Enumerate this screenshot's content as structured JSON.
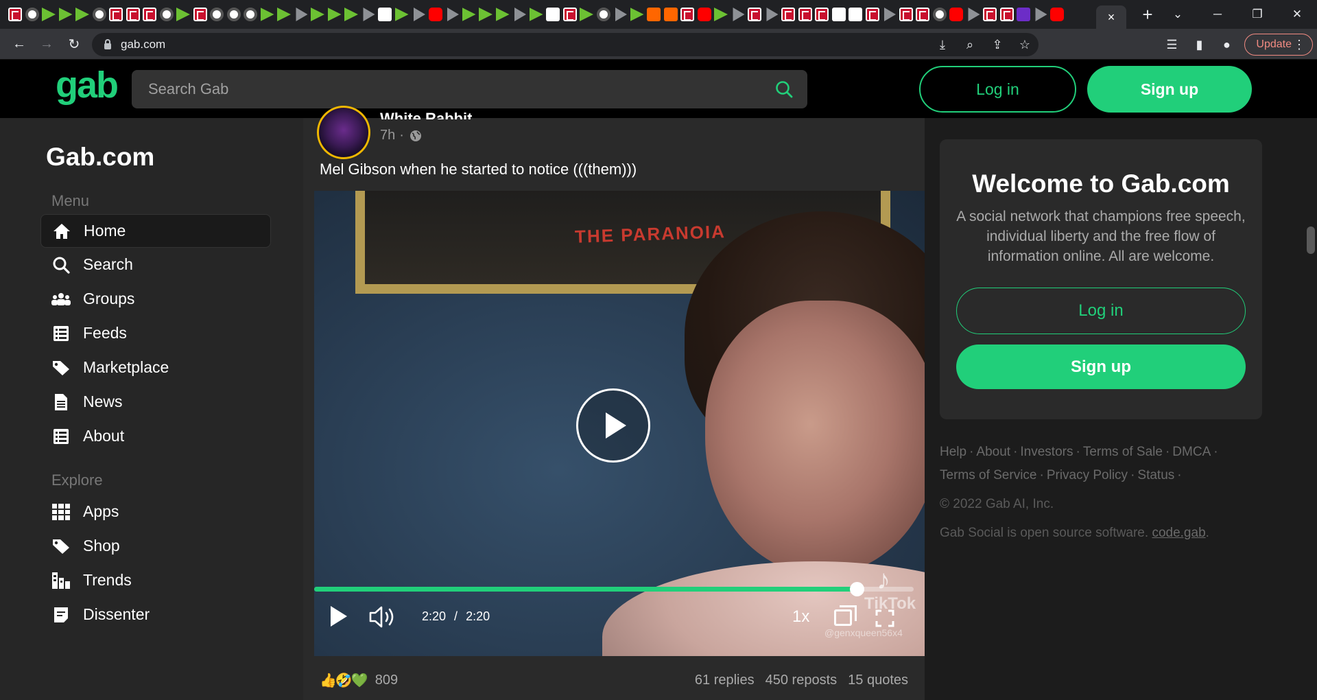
{
  "browser": {
    "url": "gab.com",
    "update_label": "Update",
    "active_tab_close": "×",
    "new_tab": "+",
    "mini_tabs": [
      "b",
      "c",
      "r",
      "r",
      "r",
      "c",
      "b",
      "b",
      "b",
      "c",
      "r",
      "b",
      "c",
      "c",
      "c",
      "r",
      "r",
      "g",
      "r",
      "r",
      "r",
      "g",
      "k",
      "r",
      "g",
      "y",
      "g",
      "r",
      "r",
      "r",
      "g",
      "r",
      "k",
      "b",
      "r",
      "c",
      "g",
      "r",
      "o",
      "o",
      "b",
      "y",
      "r",
      "g",
      "b",
      "g",
      "b",
      "b",
      "b",
      "k",
      "k",
      "b",
      "g",
      "b",
      "b",
      "c",
      "y",
      "g",
      "b",
      "b",
      "p",
      "g",
      "y"
    ]
  },
  "header": {
    "logo": "gab",
    "search_placeholder": "Search Gab",
    "login_label": "Log in",
    "signup_label": "Sign up"
  },
  "sidebar": {
    "site_title": "Gab.com",
    "menu_label": "Menu",
    "explore_label": "Explore",
    "menu_items": [
      {
        "label": "Home",
        "icon": "home-icon"
      },
      {
        "label": "Search",
        "icon": "search-icon"
      },
      {
        "label": "Groups",
        "icon": "groups-icon"
      },
      {
        "label": "Feeds",
        "icon": "feeds-icon"
      },
      {
        "label": "Marketplace",
        "icon": "tag-icon"
      },
      {
        "label": "News",
        "icon": "news-icon"
      },
      {
        "label": "About",
        "icon": "list-icon"
      }
    ],
    "explore_items": [
      {
        "label": "Apps",
        "icon": "apps-grid-icon"
      },
      {
        "label": "Shop",
        "icon": "tag-icon"
      },
      {
        "label": "Trends",
        "icon": "trends-icon"
      },
      {
        "label": "Dissenter",
        "icon": "dissenter-icon"
      }
    ]
  },
  "post": {
    "author_cut": "White Rabbit",
    "time": "7h",
    "text": "Mel Gibson when he started to notice (((them)))",
    "poster_text": "THE PARANOIA",
    "video": {
      "current_time": "2:20",
      "separator": "/",
      "duration": "2:20",
      "speed": "1x",
      "progress": 0.905,
      "watermark": "TikTok",
      "watermark_user": "@genxqueen56x4"
    },
    "reaction_emojis": [
      "👍",
      "🤣",
      "💚"
    ],
    "reaction_count": "809",
    "replies": "61 replies",
    "reposts": "450 reposts",
    "quotes": "15 quotes"
  },
  "right_panel": {
    "welcome_title": "Welcome to Gab.com",
    "welcome_text": "A social network that champions free speech, individual liberty and the free flow of information online. All are welcome.",
    "login_label": "Log in",
    "signup_label": "Sign up",
    "footer_links": [
      "Help",
      "About",
      "Investors",
      "Terms of Sale",
      "DMCA",
      "Terms of Service",
      "Privacy Policy",
      "Status"
    ],
    "copyright": "© 2022 Gab AI, Inc.",
    "opensource_text": "Gab Social is open source software.",
    "opensource_link": "code.gab"
  },
  "colors": {
    "accent": "#21cf7a",
    "header_bg": "#000000",
    "sidebar_bg": "#262626",
    "card_bg": "#2a2a2a"
  }
}
